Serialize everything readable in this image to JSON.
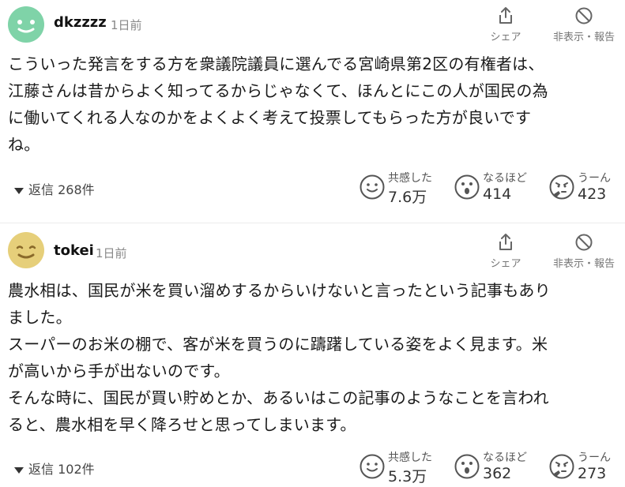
{
  "comments": [
    {
      "username": "dkzzzz",
      "time": "1日前",
      "avatar_color": "#7fd3a8",
      "share_label": "シェア",
      "hide_label": "非表示・報告",
      "lines": [
        "こういった発言をする方を衆議院議員に選んでる宮崎県第2区の有権者は、",
        "江藤さんは昔からよく知ってるからじゃなくて、ほんとにこの人が国民の為",
        "に働いてくれる人なのかをよくよく考えて投票してもらった方が良いです",
        "ね。"
      ],
      "replies": "返信 268件",
      "reactions": [
        {
          "label": "共感した",
          "count": "7.6万",
          "icon": "smile-face-icon"
        },
        {
          "label": "なるほど",
          "count": "414",
          "icon": "surprised-face-icon"
        },
        {
          "label": "うーん",
          "count": "423",
          "icon": "thinking-face-icon"
        }
      ]
    },
    {
      "username": "tokei",
      "time": "1日前",
      "avatar_color": "#e6cf7a",
      "share_label": "シェア",
      "hide_label": "非表示・報告",
      "lines": [
        "農水相は、国民が米を買い溜めするからいけないと言ったという記事もあり",
        "ました。",
        "スーパーのお米の棚で、客が米を買うのに躊躇している姿をよく見ます。米",
        "が高いから手が出ないのです。",
        "そんな時に、国民が買い貯めとか、あるいはこの記事のようなことを言われ",
        "ると、農水相を早く降ろせと思ってしまいます。"
      ],
      "replies": "返信 102件",
      "reactions": [
        {
          "label": "共感した",
          "count": "5.3万",
          "icon": "smile-face-icon"
        },
        {
          "label": "なるほど",
          "count": "362",
          "icon": "surprised-face-icon"
        },
        {
          "label": "うーん",
          "count": "273",
          "icon": "thinking-face-icon"
        }
      ]
    }
  ]
}
